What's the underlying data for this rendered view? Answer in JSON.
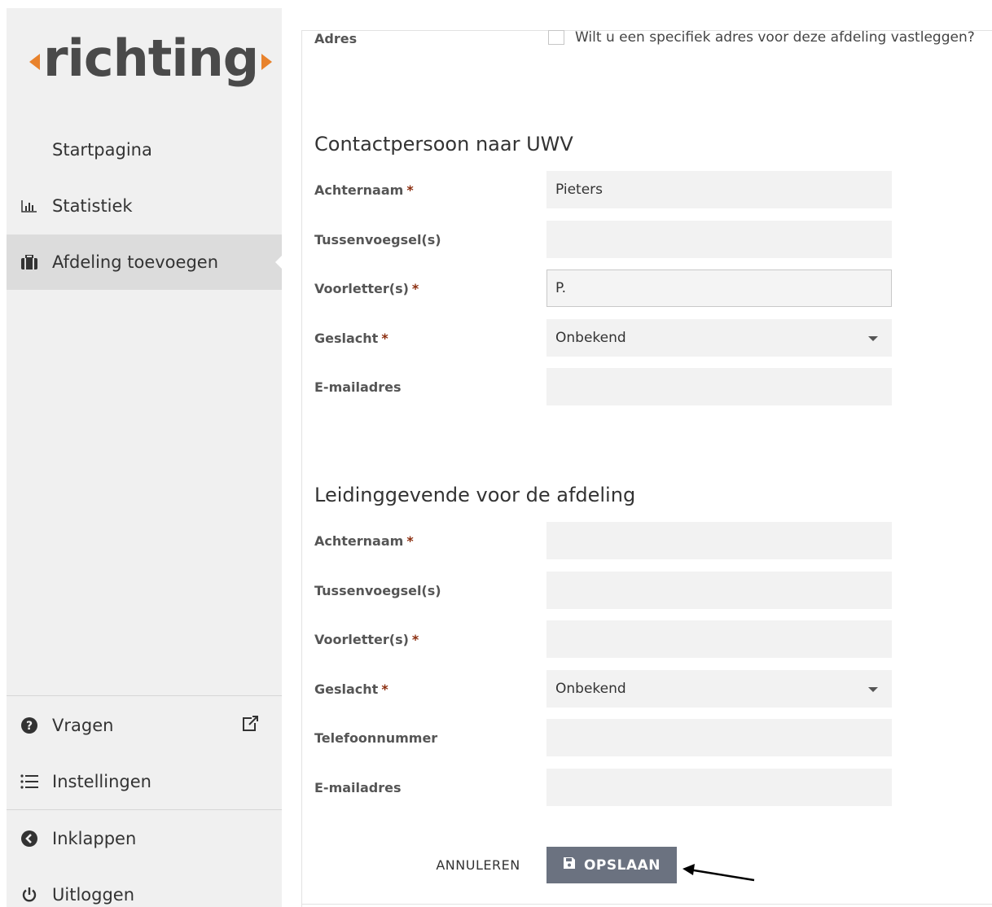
{
  "brand": {
    "logo_text": "richting"
  },
  "sidebar": {
    "items": [
      {
        "label": "Startpagina",
        "icon": "none"
      },
      {
        "label": "Statistiek",
        "icon": "bar-chart-icon"
      },
      {
        "label": "Afdeling toevoegen",
        "icon": "briefcase-icon"
      }
    ],
    "bottom_items": [
      {
        "label": "Vragen",
        "icon": "question-circle-icon"
      },
      {
        "label": "Instellingen",
        "icon": "list-icon"
      },
      {
        "label": "Inklappen",
        "icon": "chevron-left-circle-icon"
      },
      {
        "label": "Uitloggen",
        "icon": "power-icon"
      }
    ]
  },
  "address": {
    "label": "Adres",
    "checkbox_label": "Wilt u een specifiek adres voor deze afdeling vastleggen?",
    "checked": false
  },
  "contact": {
    "title": "Contactpersoon naar UWV",
    "fields": [
      {
        "label": "Achternaam",
        "required": "*",
        "value": "Pieters"
      },
      {
        "label": "Tussenvoegsel(s)",
        "required": "",
        "value": ""
      },
      {
        "label": "Voorletter(s)",
        "required": "*",
        "value": "P."
      },
      {
        "label": "Geslacht",
        "required": "*",
        "value": "Onbekend"
      },
      {
        "label": "E-mailadres",
        "required": "",
        "value": ""
      }
    ]
  },
  "manager": {
    "title": "Leidinggevende voor de afdeling",
    "fields": [
      {
        "label": "Achternaam",
        "required": "*",
        "value": ""
      },
      {
        "label": "Tussenvoegsel(s)",
        "required": "",
        "value": ""
      },
      {
        "label": "Voorletter(s)",
        "required": "*",
        "value": ""
      },
      {
        "label": "Geslacht",
        "required": "*",
        "value": "Onbekend"
      },
      {
        "label": "Telefoonnummer",
        "required": "",
        "value": ""
      },
      {
        "label": "E-mailadres",
        "required": "",
        "value": ""
      }
    ]
  },
  "actions": {
    "cancel_label": "ANNULEREN",
    "save_label": "OPSLAAN"
  },
  "colors": {
    "accent": "#e8822c",
    "save_button": "#6b7280",
    "required": "#8b2d0e"
  }
}
